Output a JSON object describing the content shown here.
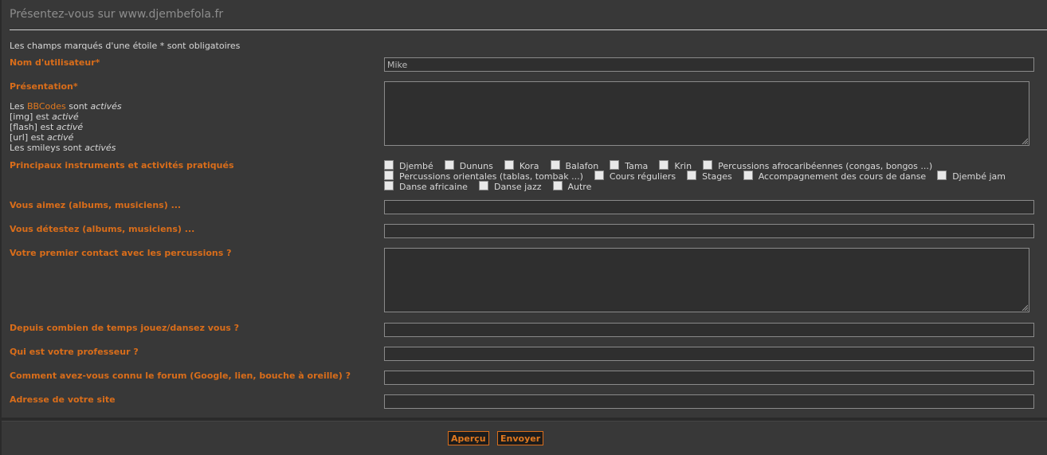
{
  "page": {
    "title": "Présentez-vous sur www.djembefola.fr",
    "note": "Les champs marqués d'une étoile * sont obligatoires"
  },
  "fields": {
    "username": {
      "label": "Nom d'utilisateur*",
      "value": "Mike"
    },
    "presentation": {
      "label": "Présentation*"
    },
    "bbcode": {
      "l1_pre": "Les ",
      "l1_link": "BBCodes",
      "l1_mid": " sont ",
      "l1_em": "activés",
      "l2_pre": "[img] est ",
      "l2_em": "activé",
      "l3_pre": "[flash] est ",
      "l3_em": "activé",
      "l4_pre": "[url] est ",
      "l4_em": "activé",
      "l5_pre": "Les smileys sont ",
      "l5_em": "activés"
    },
    "instruments": {
      "label": "Principaux instruments et activités pratiqués",
      "row1": [
        "Djembé",
        "Dununs",
        "Kora",
        "Balafon",
        "Tama",
        "Krin",
        "Percussions afrocaribéennes (congas, bongos ...)"
      ],
      "row2": [
        "Percussions orientales (tablas, tombak ...)",
        "Cours réguliers",
        "Stages",
        "Accompagnement des cours de danse",
        "Djembé jam"
      ],
      "row3": [
        "Danse africaine",
        "Danse jazz",
        "Autre"
      ]
    },
    "likes": {
      "label": "Vous aimez (albums, musiciens) ..."
    },
    "dislikes": {
      "label": "Vous détestez (albums, musiciens) ..."
    },
    "first_contact": {
      "label": "Votre premier contact avec les percussions ?"
    },
    "duration": {
      "label": "Depuis combien de temps jouez/dansez vous ?"
    },
    "teacher": {
      "label": "Qui est votre professeur ?"
    },
    "how_known": {
      "label": "Comment avez-vous connu le forum (Google, lien, bouche à oreille) ?"
    },
    "website": {
      "label": "Adresse de votre site"
    }
  },
  "buttons": {
    "preview": "Aperçu",
    "submit": "Envoyer"
  }
}
